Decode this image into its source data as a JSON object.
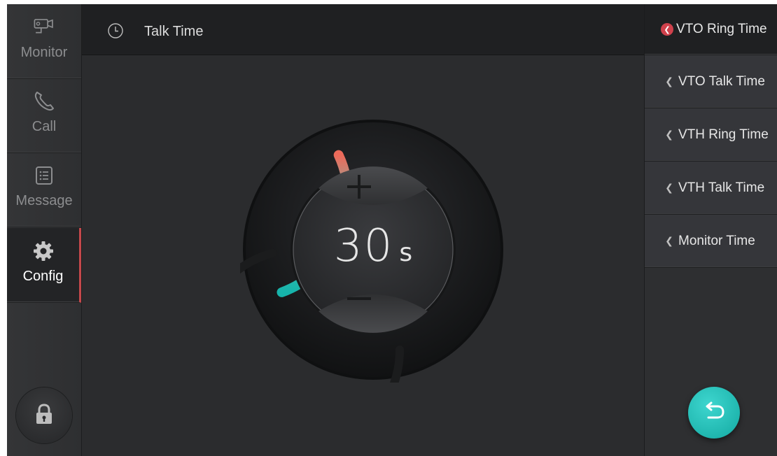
{
  "sidebar": {
    "items": [
      {
        "label": "Monitor",
        "icon": "camera-icon",
        "active": false
      },
      {
        "label": "Call",
        "icon": "phone-icon",
        "active": false
      },
      {
        "label": "Message",
        "icon": "message-list-icon",
        "active": false
      },
      {
        "label": "Config",
        "icon": "gear-icon",
        "active": true
      }
    ],
    "lock_icon": "lock-icon"
  },
  "header": {
    "icon": "clock-icon",
    "title": "Talk Time"
  },
  "dial": {
    "value": "30",
    "unit": "s",
    "level_fraction": 0.25,
    "increase_icon": "plus-icon",
    "decrease_icon": "minus-icon"
  },
  "menu": {
    "items": [
      {
        "label": "VTO Ring Time",
        "active": true
      },
      {
        "label": "VTO Talk Time",
        "active": false
      },
      {
        "label": "VTH Ring Time",
        "active": false
      },
      {
        "label": "VTH Talk Time",
        "active": false
      },
      {
        "label": "Monitor Time",
        "active": false
      }
    ],
    "back_icon": "back-arrow-icon"
  },
  "colors": {
    "accent_teal": "#1fb7af",
    "accent_red": "#e4685c",
    "active_marker": "#c5484b"
  }
}
